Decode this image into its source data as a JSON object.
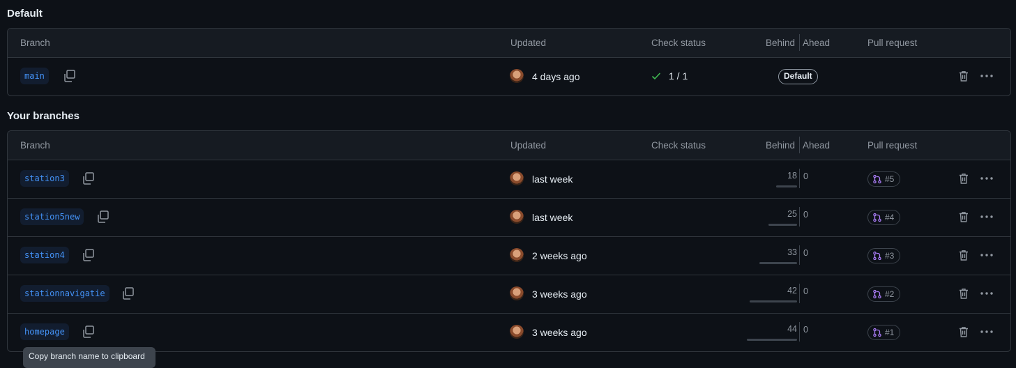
{
  "sections": {
    "default_title": "Default",
    "yours_title": "Your branches"
  },
  "columns": {
    "branch": "Branch",
    "updated": "Updated",
    "check_status": "Check status",
    "behind": "Behind",
    "ahead": "Ahead",
    "pull_request": "Pull request"
  },
  "default_branch": {
    "name": "main",
    "updated": "4 days ago",
    "check": "1 / 1",
    "badge": "Default"
  },
  "branches": [
    {
      "name": "station3",
      "updated": "last week",
      "behind": "18",
      "behind_fraction": 0.41,
      "ahead": "0",
      "pr": "#5"
    },
    {
      "name": "station5new",
      "updated": "last week",
      "behind": "25",
      "behind_fraction": 0.57,
      "ahead": "0",
      "pr": "#4"
    },
    {
      "name": "station4",
      "updated": "2 weeks ago",
      "behind": "33",
      "behind_fraction": 0.75,
      "ahead": "0",
      "pr": "#3"
    },
    {
      "name": "stationnavigatie",
      "updated": "3 weeks ago",
      "behind": "42",
      "behind_fraction": 0.95,
      "ahead": "0",
      "pr": "#2"
    },
    {
      "name": "homepage",
      "updated": "3 weeks ago",
      "behind": "44",
      "behind_fraction": 1.0,
      "ahead": "0",
      "pr": "#1"
    }
  ],
  "tooltip": "Copy branch name to clipboard",
  "colors": {
    "background": "#0d1117",
    "header": "#161b22",
    "border": "#30363d",
    "branch_text": "#4493f8",
    "branch_bg": "#121d2f",
    "success": "#3fb950",
    "pr_open": "#ab7df8"
  }
}
